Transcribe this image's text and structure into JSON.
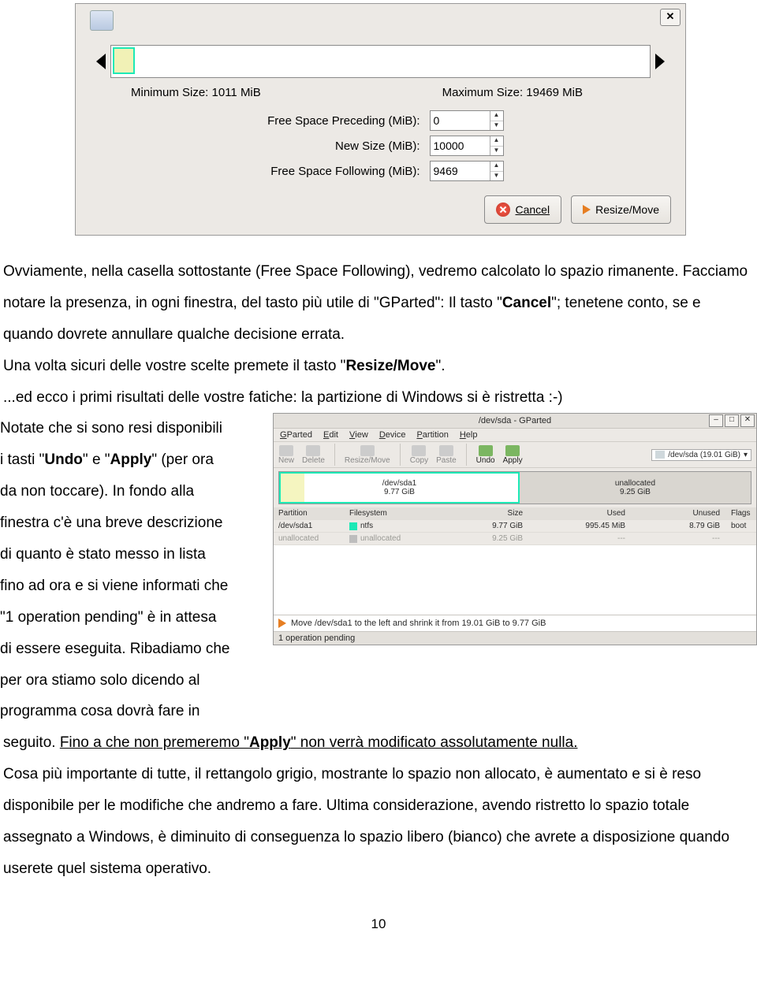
{
  "dialog1": {
    "min_size_label": "Minimum Size: 1011 MiB",
    "max_size_label": "Maximum Size: 19469 MiB",
    "field_preceding_label": "Free Space Preceding (MiB):",
    "field_preceding_value": "0",
    "field_newsize_label": "New Size (MiB):",
    "field_newsize_value": "10000",
    "field_following_label": "Free Space Following (MiB):",
    "field_following_value": "9469",
    "cancel_label": "Cancel",
    "resize_label": "Resize/Move"
  },
  "prose": {
    "p1a": "Ovviamente, nella casella sottostante (Free Space Following), vedremo calcolato lo spazio rimanente. Facciamo notare la presenza, in ogni finestra, del tasto più utile di \"GParted\": Il tasto \"",
    "p1b": "Cancel",
    "p1c": "\"; tenetene conto, se e quando dovrete annullare qualche decisione errata.",
    "p2a": "Una volta sicuri delle vostre scelte premete il tasto \"",
    "p2b": "Resize/Move",
    "p2c": "\".",
    "p3": "...ed ecco i primi risultati delle vostre fatiche: la partizione di Windows si è ristretta  :-)",
    "left1": "Notate che si sono resi disponibili",
    "left2a": " i tasti \"",
    "left2b": "Undo",
    "left2c": "\" e \"",
    "left2d": "Apply",
    "left2e": "\" (per ora",
    "left3": " da non toccare). In fondo alla",
    "left4": " finestra c'è una breve descrizione",
    "left5": " di quanto è stato messo in lista",
    "left6": " fino ad ora e si viene informati che",
    "left7": " \"1 operation pending\" è in attesa",
    "left8": "di essere eseguita. Ribadiamo che",
    "left9": "per ora stiamo solo dicendo al",
    "left10": "programma cosa dovrà fare in",
    "p4a": "seguito. ",
    "p4b": "Fino a che non premeremo \"",
    "p4c": "Apply",
    "p4d": "\" non verrà modificato assolutamente nulla.",
    "p5": "Cosa più importante di tutte, il rettangolo grigio, mostrante lo spazio non allocato, è aumentato e si è reso disponibile per le modifiche che andremo a fare. Ultima considerazione, avendo ristretto lo spazio totale assegnato a Windows, è diminuito di conseguenza lo spazio libero (bianco) che avrete a disposizione quando userete quel sistema operativo."
  },
  "gparted": {
    "title": "/dev/sda - GParted",
    "menu": [
      "GParted",
      "Edit",
      "View",
      "Device",
      "Partition",
      "Help"
    ],
    "menu_ul_index": [
      0,
      0,
      0,
      0,
      0,
      0
    ],
    "toolbar": {
      "new": "New",
      "delete": "Delete",
      "resize": "Resize/Move",
      "copy": "Copy",
      "paste": "Paste",
      "undo": "Undo",
      "apply": "Apply"
    },
    "device_selector": "/dev/sda    (19.01 GiB)",
    "disk": {
      "part_name": "/dev/sda1",
      "part_size": "9.77 GiB",
      "unalloc_name": "unallocated",
      "unalloc_size": "9.25 GiB"
    },
    "cols": {
      "partition": "Partition",
      "filesystem": "Filesystem",
      "size": "Size",
      "used": "Used",
      "unused": "Unused",
      "flags": "Flags"
    },
    "rows": [
      {
        "partition": "/dev/sda1",
        "fs": "ntfs",
        "size": "9.77 GiB",
        "used": "995.45 MiB",
        "unused": "8.79 GiB",
        "flags": "boot"
      },
      {
        "partition": "unallocated",
        "fs": "unallocated",
        "size": "9.25 GiB",
        "used": "---",
        "unused": "---",
        "flags": ""
      }
    ],
    "operation": "Move /dev/sda1 to the left and shrink it from 19.01 GiB to 9.77 GiB",
    "status": "1 operation pending"
  },
  "page_number": "10"
}
